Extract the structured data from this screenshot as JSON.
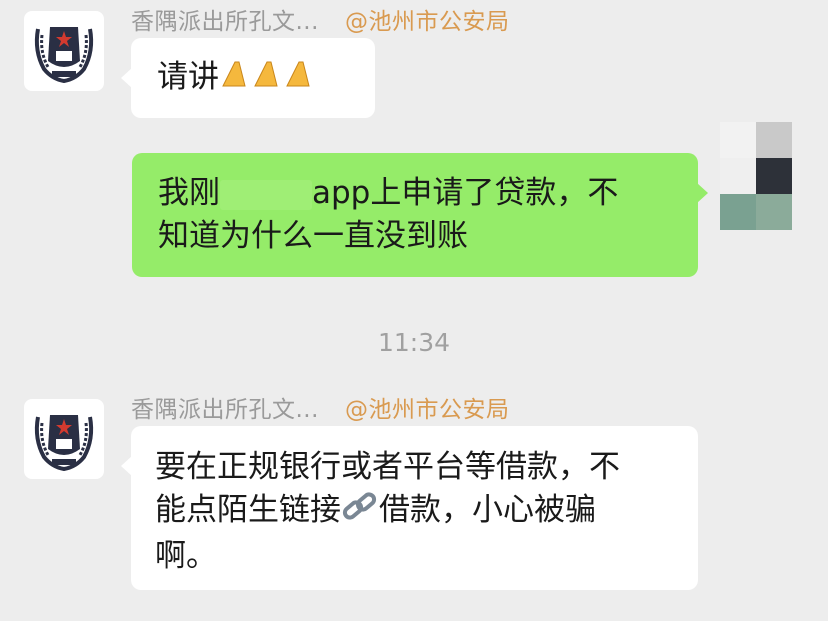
{
  "messages": [
    {
      "sender": "香隅派出所孔文...",
      "mention": "@池州市公安局",
      "text": "请讲",
      "emoji": [
        "folded-hands",
        "folded-hands",
        "folded-hands"
      ]
    },
    {
      "from_self": true,
      "text_prefix": "我刚",
      "text_suffix": "app上申请了贷款，不",
      "text_line2": "知道为什么一直没到账"
    },
    {
      "timestamp": "11:34"
    },
    {
      "sender": "香隅派出所孔文...",
      "mention": "@池州市公安局",
      "line1": "要在正规银行或者平台等借款，不",
      "line2_a": "能点陌生链接",
      "line2_b": "借款，小心被骗",
      "line3": "啊。",
      "emoji": [
        "link"
      ]
    }
  ],
  "colors": {
    "background": "#ededed",
    "bubble_self": "#95ec69",
    "bubble_other": "#ffffff",
    "mention": "#d99a50"
  },
  "icons": [
    "police-badge-avatar-icon",
    "folded-hands-icon",
    "link-icon",
    "pixelated-avatar"
  ]
}
